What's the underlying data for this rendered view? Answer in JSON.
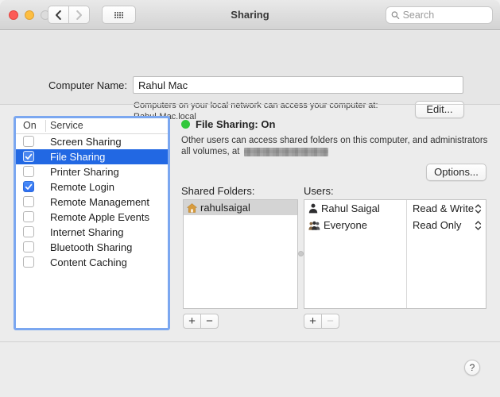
{
  "titlebar": {
    "title": "Sharing",
    "search_placeholder": "Search"
  },
  "computer_name": {
    "label": "Computer Name:",
    "value": "Rahul Mac",
    "help_line1": "Computers on your local network can access your computer at:",
    "help_line2": "Rahul-Mac.local",
    "edit_button": "Edit..."
  },
  "services": {
    "header": {
      "on": "On",
      "service": "Service"
    },
    "items": [
      {
        "label": "Screen Sharing",
        "checked": false,
        "selected": false
      },
      {
        "label": "File Sharing",
        "checked": true,
        "selected": true
      },
      {
        "label": "Printer Sharing",
        "checked": false,
        "selected": false
      },
      {
        "label": "Remote Login",
        "checked": true,
        "selected": false
      },
      {
        "label": "Remote Management",
        "checked": false,
        "selected": false
      },
      {
        "label": "Remote Apple Events",
        "checked": false,
        "selected": false
      },
      {
        "label": "Internet Sharing",
        "checked": false,
        "selected": false
      },
      {
        "label": "Bluetooth Sharing",
        "checked": false,
        "selected": false
      },
      {
        "label": "Content Caching",
        "checked": false,
        "selected": false
      }
    ]
  },
  "detail": {
    "status_label": "File Sharing: On",
    "desc_line1": "Other users can access shared folders on this computer, and administrators",
    "desc_line2_prefix": "all volumes, at",
    "desc_address_redacted": true,
    "options_button": "Options...",
    "shared_folders": {
      "label": "Shared Folders:",
      "items": [
        {
          "name": "rahulsaigal",
          "icon": "home-folder-icon",
          "selected": true
        }
      ],
      "add_label": "+",
      "remove_label": "−"
    },
    "users": {
      "label": "Users:",
      "rows": [
        {
          "name": "Rahul Saigal",
          "icon": "user-icon",
          "permission": "Read & Write"
        },
        {
          "name": "Everyone",
          "icon": "group-icon",
          "permission": "Read Only"
        }
      ],
      "add_label": "+",
      "remove_label": "−"
    }
  },
  "help_button_label": "?",
  "icons": {
    "window_controls": [
      "close",
      "minimize",
      "zoom-disabled"
    ],
    "back": "chevron-left",
    "forward": "chevron-right",
    "show_all": "grid-of-dots",
    "search": "magnifier",
    "status": "green-dot",
    "shared_folder": "home",
    "user": "person-silhouette",
    "everyone": "group-silhouette",
    "permission_selector": "up-down-chevrons",
    "help": "question-mark"
  },
  "colors": {
    "selection_blue": "#2268e3",
    "focus_ring": "#7ba7f0",
    "checkbox_blue": "#3478f6",
    "status_green": "#32c73c"
  }
}
